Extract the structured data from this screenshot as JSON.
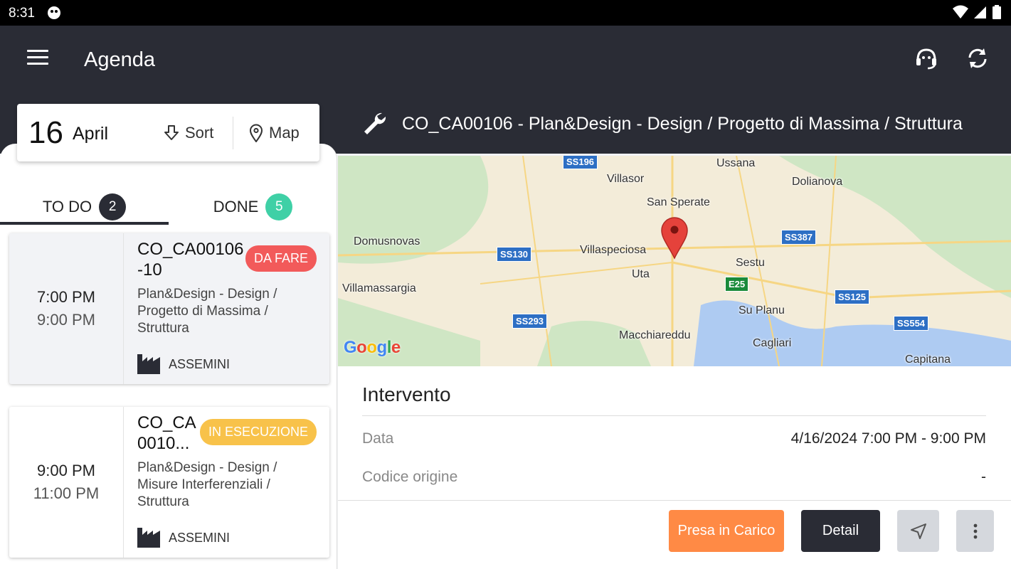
{
  "status_bar": {
    "time": "8:31"
  },
  "app_bar": {
    "title": "Agenda"
  },
  "date_card": {
    "day": "16",
    "month": "April",
    "sort_label": "Sort",
    "map_label": "Map"
  },
  "tabs": [
    {
      "label": "TO DO",
      "count": "2",
      "active": true
    },
    {
      "label": "DONE",
      "count": "5",
      "active": false
    }
  ],
  "appointments": [
    {
      "start": "7:00 PM",
      "end": "9:00 PM",
      "code": "CO_CA00106 -10",
      "badge": "DA FARE",
      "badge_color": "#f25a5a",
      "description": "Plan&Design - Design / Progetto di Massima / Struttura",
      "location": "ASSEMINI"
    },
    {
      "start": "9:00 PM",
      "end": "11:00 PM",
      "code": "CO_CA 0010...",
      "badge": "IN ESECUZIONE",
      "badge_color": "#f8c24a",
      "description": "Plan&Design - Design / Misure Interferenziali / Struttura",
      "location": "ASSEMINI"
    }
  ],
  "detail": {
    "title": "CO_CA00106 - Plan&Design - Design / Progetto di Massima / Struttura",
    "section_title": "Intervento",
    "rows": [
      {
        "key": "Data",
        "value": "4/16/2024 7:00 PM - 9:00 PM"
      },
      {
        "key": "Codice origine",
        "value": "-"
      }
    ]
  },
  "map": {
    "places": [
      "Ussana",
      "Villasor",
      "Dolianova",
      "San Sperate",
      "Domusnovas",
      "Villaspeciosa",
      "Sestu",
      "Uta",
      "Villamassargia",
      "Su Planu",
      "Macchiareddu",
      "Cagliari",
      "Capitana"
    ],
    "road_shields": [
      "SS196",
      "SS387",
      "SS130",
      "E25",
      "SS125",
      "SS293",
      "SS554"
    ],
    "attribution": "Google"
  },
  "actions": {
    "take_charge": "Presa in Carico",
    "detail": "Detail"
  },
  "colors": {
    "header": "#2a2c35",
    "todo_count": "#2a2c35",
    "done_count": "#3fd0a6",
    "take_charge": "#ff8a45",
    "detail_button": "#2a2c35"
  }
}
